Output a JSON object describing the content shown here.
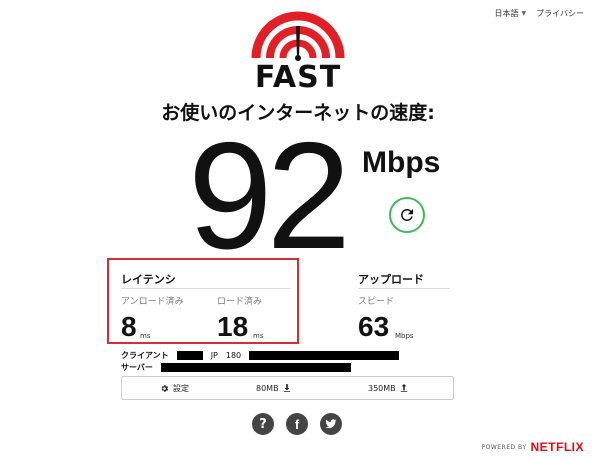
{
  "topnav": {
    "language": "日本語",
    "privacy": "プライバシー"
  },
  "logo": {
    "text": "FAST"
  },
  "headline": "お使いのインターネットの速度:",
  "speed": {
    "value": "92",
    "unit": "Mbps"
  },
  "latency": {
    "title": "レイテンシ",
    "unloaded_label": "アンロード済み",
    "unloaded_value": "8",
    "unloaded_unit": "ms",
    "loaded_label": "ロード済み",
    "loaded_value": "18",
    "loaded_unit": "ms"
  },
  "upload": {
    "title": "アップロード",
    "label": "スピード",
    "value": "63",
    "unit": "Mbps"
  },
  "client": {
    "label": "クライアント",
    "country": "JP",
    "partial": "180"
  },
  "server": {
    "label": "サーバー"
  },
  "settings": {
    "label": "設定",
    "download_size": "80MB",
    "upload_size": "350MB"
  },
  "footer": {
    "powered_by": "POWERED BY",
    "brand": "NETFLIX"
  },
  "colors": {
    "red": "#d32f3a",
    "green": "#3fba5a",
    "netflix": "#e50914"
  }
}
